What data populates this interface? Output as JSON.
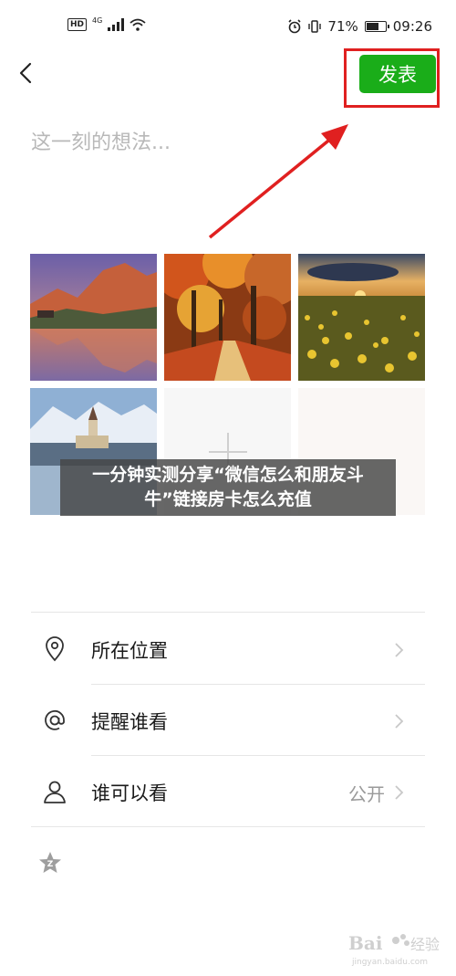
{
  "status_bar": {
    "hd": "HD",
    "network": "4G",
    "battery": "71%",
    "battery_level": 0.71,
    "time": "09:26"
  },
  "header": {
    "publish_label": "发表"
  },
  "compose": {
    "placeholder": "这一刻的想法..."
  },
  "overlay": {
    "line1": "一分钟实测分享“微信怎么和朋友斗",
    "line2": "牛”链接房卡怎么充值"
  },
  "options": [
    {
      "label": "所在位置",
      "value": ""
    },
    {
      "label": "提醒谁看",
      "value": ""
    },
    {
      "label": "谁可以看",
      "value": "公开"
    }
  ],
  "watermark": {
    "logo": "Bai du 经验",
    "url": "jingyan.baidu.com"
  },
  "colors": {
    "accent": "#1AAD19",
    "annotation": "#e02020"
  }
}
